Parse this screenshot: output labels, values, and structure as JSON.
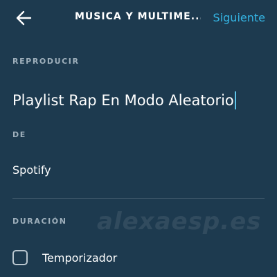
{
  "header": {
    "back_icon": "arrow-left-icon",
    "title": "MÚSICA Y MULTIME...",
    "next_label": "Siguiente"
  },
  "play_section": {
    "label": "REPRODUCIR",
    "value": "Playlist Rap En Modo Aleatorio"
  },
  "source_section": {
    "label": "DE",
    "value": "Spotify"
  },
  "duration_section": {
    "label": "DURACIÓN",
    "timer_label": "Temporizador",
    "timer_checked": false
  },
  "watermark": "alexaesp.es",
  "colors": {
    "background": "#1d3a4f",
    "accent": "#34b4e3",
    "section_label": "#9fb0bc",
    "divider": "#3b5567"
  }
}
